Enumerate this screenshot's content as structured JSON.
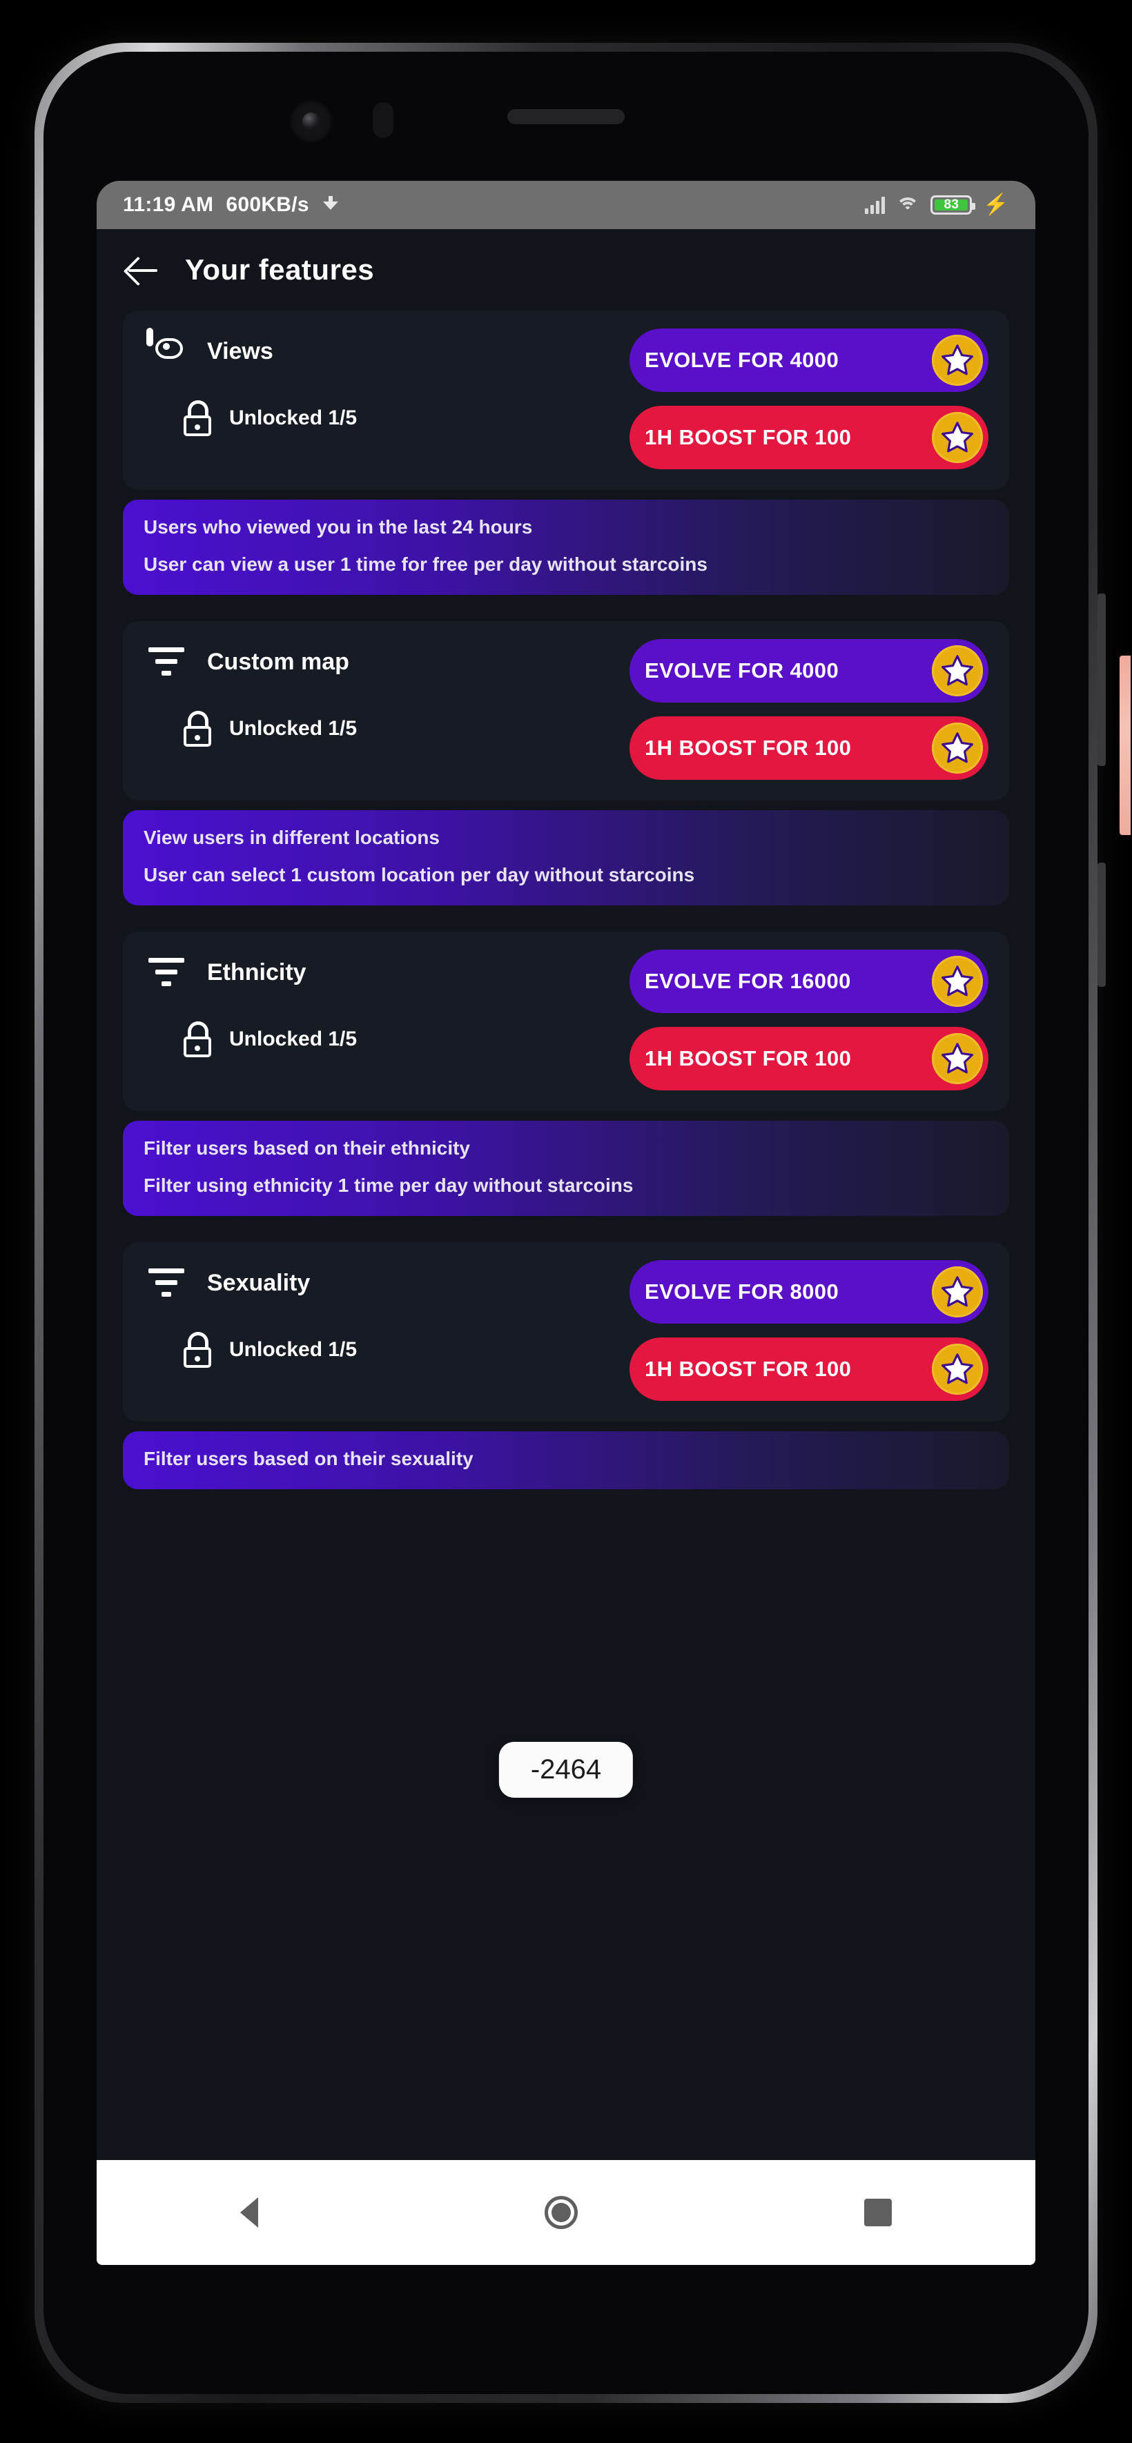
{
  "status_bar": {
    "time": "11:19 AM",
    "network_speed": "600KB/s",
    "download_icon": "download-icon",
    "signal_icon": "cellular-signal-icon",
    "wifi_icon": "wifi-icon",
    "battery_percent": "83",
    "charging_icon": "charging-bolt-icon",
    "battery_color": "#3ec63e"
  },
  "appbar": {
    "back_icon": "back-arrow-icon",
    "title": "Your features"
  },
  "colors": {
    "screen_bg": "#11141b",
    "card_bg": "#171b24",
    "evolve_purple": "#5a0fc8",
    "boost_red": "#e31740",
    "coin_gold": "#e8ae10",
    "banner_purple": "#4b10d0"
  },
  "toast": {
    "text": "-2464"
  },
  "features": [
    {
      "icon": "eye-icon",
      "title": "Views",
      "lock_icon": "unlocked-padlock-icon",
      "lock_text": "Unlocked 1/5",
      "evolve_label": "EVOLVE FOR 4000",
      "boost_label": "1H BOOST FOR 100",
      "coin_icon": "starcoin-icon",
      "desc_line1": "Users who viewed you in the last 24 hours",
      "desc_line2": "User can view a user 1 time for free per day without starcoins"
    },
    {
      "icon": "filter-icon",
      "title": "Custom map",
      "lock_icon": "unlocked-padlock-icon",
      "lock_text": "Unlocked 1/5",
      "evolve_label": "EVOLVE FOR 4000",
      "boost_label": "1H BOOST FOR 100",
      "coin_icon": "starcoin-icon",
      "desc_line1": "View users in different locations",
      "desc_line2": "User can select 1 custom location per day without starcoins"
    },
    {
      "icon": "filter-icon",
      "title": "Ethnicity",
      "lock_icon": "unlocked-padlock-icon",
      "lock_text": "Unlocked 1/5",
      "evolve_label": "EVOLVE FOR 16000",
      "boost_label": "1H BOOST FOR 100",
      "coin_icon": "starcoin-icon",
      "desc_line1": "Filter users based on their ethnicity",
      "desc_line2": "Filter using ethnicity 1 time per day without starcoins"
    },
    {
      "icon": "filter-icon",
      "title": "Sexuality",
      "lock_icon": "unlocked-padlock-icon",
      "lock_text": "Unlocked 1/5",
      "evolve_label": "EVOLVE FOR 8000",
      "boost_label": "1H BOOST FOR 100",
      "coin_icon": "starcoin-icon",
      "desc_line1": "Filter users based on their sexuality",
      "desc_line2": ""
    }
  ],
  "navbar": {
    "back": "nav-back-icon",
    "home": "nav-home-icon",
    "recents": "nav-recents-icon"
  }
}
